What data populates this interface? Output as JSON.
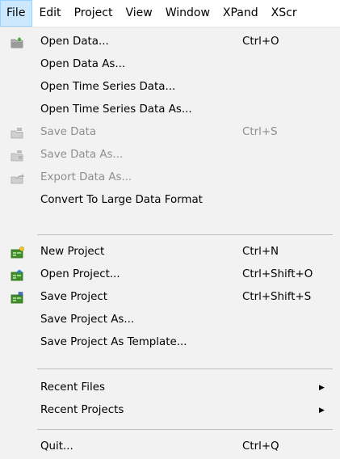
{
  "menubar": [
    {
      "label": "File",
      "active": true
    },
    {
      "label": "Edit"
    },
    {
      "label": "Project"
    },
    {
      "label": "View"
    },
    {
      "label": "Window"
    },
    {
      "label": "XPand"
    },
    {
      "label": "XScr"
    }
  ],
  "menu": {
    "open_data": {
      "label": "Open Data...",
      "shortcut": "Ctrl+O",
      "icon": "folder-open-icon"
    },
    "open_data_as": {
      "label": "Open Data As..."
    },
    "open_ts_data": {
      "label": "Open Time Series Data..."
    },
    "open_ts_data_as": {
      "label": "Open Time Series Data As..."
    },
    "save_data": {
      "label": "Save Data",
      "shortcut": "Ctrl+S",
      "icon": "save-data-icon",
      "disabled": true
    },
    "save_data_as": {
      "label": "Save Data As...",
      "icon": "save-data-as-icon",
      "disabled": true
    },
    "export_data_as": {
      "label": "Export Data As...",
      "icon": "export-icon",
      "disabled": true
    },
    "convert_large": {
      "label": "Convert To Large Data Format"
    },
    "new_project": {
      "label": "New Project",
      "shortcut": "Ctrl+N",
      "icon": "new-project-icon"
    },
    "open_project": {
      "label": "Open Project...",
      "shortcut": "Ctrl+Shift+O",
      "icon": "open-project-icon"
    },
    "save_project": {
      "label": "Save Project",
      "shortcut": "Ctrl+Shift+S",
      "icon": "save-project-icon"
    },
    "save_project_as": {
      "label": "Save Project As..."
    },
    "save_project_template": {
      "label": "Save Project As Template..."
    },
    "recent_files": {
      "label": "Recent Files",
      "submenu": true
    },
    "recent_projects": {
      "label": "Recent Projects",
      "submenu": true
    },
    "quit": {
      "label": "Quit...",
      "shortcut": "Ctrl+Q"
    }
  },
  "colors": {
    "menu_bg": "#f2f2f2",
    "active_menubar_bg": "#cce8ff",
    "disabled_text": "#8e8e8e",
    "project_icon_green": "#3f8f2a"
  }
}
